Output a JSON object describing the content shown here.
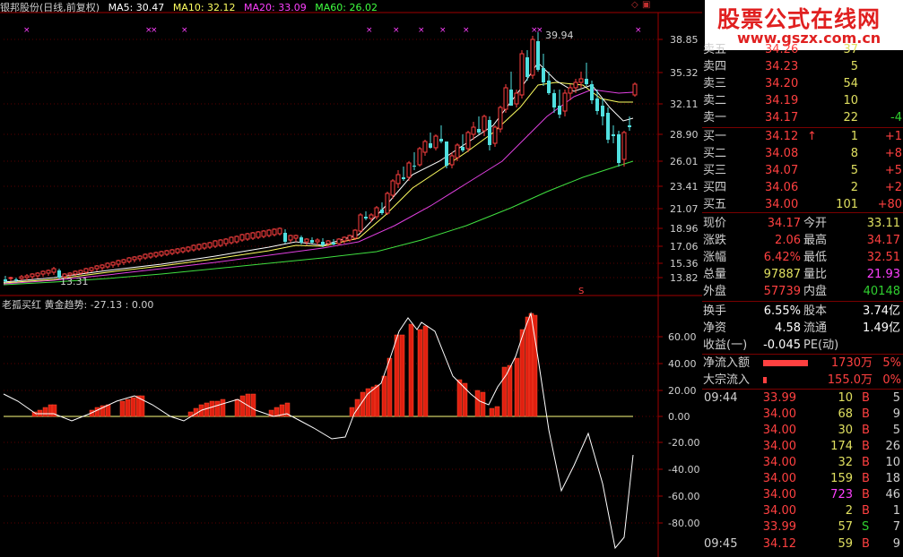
{
  "header": {
    "stock_title": "银邦股份(日线,前复权)",
    "ma5": "MA5: 30.47",
    "ma10": "MA10: 32.12",
    "ma20": "MA20: 33.09",
    "ma60": "MA60: 26.02",
    "colors": {
      "ma5": "#ffffff",
      "ma10": "#ffff60",
      "ma20": "#ff40ff",
      "ma60": "#40ff40"
    }
  },
  "watermark": {
    "line1": "股票公式在线网",
    "line2": "www.gszx.com.cn"
  },
  "main_chart": {
    "price_labels": [
      "38.85",
      "35.32",
      "32.11",
      "28.90",
      "26.01",
      "23.41",
      "21.07",
      "18.96",
      "17.06",
      "15.36",
      "13.82"
    ],
    "high_label": "39.94",
    "low_label": "13.31",
    "marker_symbol": "×",
    "s_symbol": "S"
  },
  "indicator": {
    "title": "老孤买红  黄金趋势: -27.13 : 0.00",
    "axis_labels": [
      "60.00",
      "40.00",
      "20.00",
      "0.00",
      "-20.00",
      "-40.00",
      "-60.00",
      "-80.00"
    ]
  },
  "order_book": {
    "sell": [
      {
        "label": "卖五",
        "price": "34.26",
        "vol": "37",
        "chg": ""
      },
      {
        "label": "卖四",
        "price": "34.23",
        "vol": "5",
        "chg": ""
      },
      {
        "label": "卖三",
        "price": "34.20",
        "vol": "54",
        "chg": ""
      },
      {
        "label": "卖二",
        "price": "34.19",
        "vol": "10",
        "chg": ""
      },
      {
        "label": "卖一",
        "price": "34.17",
        "vol": "22",
        "chg": "-4"
      }
    ],
    "buy": [
      {
        "label": "买一",
        "price": "34.12",
        "vol": "1",
        "chg": "+1",
        "arrow": "↑"
      },
      {
        "label": "买二",
        "price": "34.08",
        "vol": "8",
        "chg": "+8"
      },
      {
        "label": "买三",
        "price": "34.07",
        "vol": "5",
        "chg": "+5"
      },
      {
        "label": "买四",
        "price": "34.06",
        "vol": "2",
        "chg": "+2"
      },
      {
        "label": "买五",
        "price": "34.00",
        "vol": "101",
        "chg": "+80"
      }
    ]
  },
  "quote": [
    {
      "l1": "现价",
      "v1": "34.17",
      "l2": "今开",
      "v2": "33.11"
    },
    {
      "l1": "涨跌",
      "v1": "2.06",
      "l2": "最高",
      "v2": "34.17"
    },
    {
      "l1": "涨幅",
      "v1": "6.42%",
      "l2": "最低",
      "v2": "32.51"
    },
    {
      "l1": "总量",
      "v1": "97887",
      "l2": "量比",
      "v2": "21.93"
    },
    {
      "l1": "外盘",
      "v1": "57739",
      "l2": "内盘",
      "v2": "40148"
    }
  ],
  "stats": [
    {
      "l1": "换手",
      "v1": "6.55%",
      "l2": "股本",
      "v2": "3.74亿"
    },
    {
      "l1": "净资",
      "v1": "4.58",
      "l2": "流通",
      "v2": "1.49亿"
    },
    {
      "l1": "收益(一)",
      "v1": "-0.045",
      "l2": "PE(动)",
      "v2": ""
    }
  ],
  "flows": [
    {
      "label": "净流入额",
      "value": "1730万",
      "pct": "5%",
      "bar": 0.7
    },
    {
      "label": "大宗流入",
      "value": "155.0万",
      "pct": "0%",
      "bar": 0.05
    }
  ],
  "ticks": [
    {
      "time": "09:44",
      "price": "33.99",
      "vol": "10",
      "bs": "B",
      "n": "5"
    },
    {
      "time": "",
      "price": "34.00",
      "vol": "68",
      "bs": "B",
      "n": "9"
    },
    {
      "time": "",
      "price": "34.00",
      "vol": "30",
      "bs": "B",
      "n": "5"
    },
    {
      "time": "",
      "price": "34.00",
      "vol": "174",
      "bs": "B",
      "n": "26"
    },
    {
      "time": "",
      "price": "34.00",
      "vol": "32",
      "bs": "B",
      "n": "10"
    },
    {
      "time": "",
      "price": "34.00",
      "vol": "159",
      "bs": "B",
      "n": "18"
    },
    {
      "time": "",
      "price": "34.00",
      "vol": "723",
      "bs": "B",
      "n": "46"
    },
    {
      "time": "",
      "price": "34.00",
      "vol": "2",
      "bs": "B",
      "n": "1"
    },
    {
      "time": "",
      "price": "33.99",
      "vol": "57",
      "bs": "S",
      "n": "7"
    },
    {
      "time": "09:45",
      "price": "34.12",
      "vol": "59",
      "bs": "B",
      "n": "9"
    }
  ]
}
